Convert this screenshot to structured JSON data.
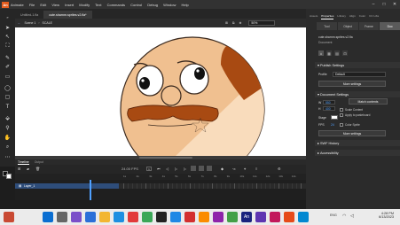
{
  "app": {
    "logo": "An",
    "menu": [
      "Animate",
      "File",
      "Edit",
      "View",
      "Insert",
      "Modify",
      "Text",
      "Commands",
      "Control",
      "Debug",
      "Window",
      "Help"
    ]
  },
  "document_tabs": [
    "Untitled-1.fla",
    "cute.sharnm.sprites.v2.fla*"
  ],
  "edit_bar": {
    "scene": "Scene 1",
    "symbol": "SCALE",
    "zoom": "50%"
  },
  "properties_panel": {
    "tabs": [
      "Assets",
      "Properties",
      "Library",
      "Align",
      "Color",
      "CC Libs"
    ],
    "view_tabs": [
      "Tool",
      "Object",
      "Frame",
      "Doc"
    ],
    "doc_name": "cute.sharnm.sprites.v2.fla",
    "doc_type": "Document",
    "publish_settings": {
      "title": "Publish Settings",
      "profile_label": "Profile",
      "profile_value": "Default",
      "more_button": "More settings"
    },
    "document_settings": {
      "title": "Document Settings",
      "w_label": "W",
      "w_value": "550",
      "h_label": "H",
      "h_value": "400",
      "match_contents": "Match contents",
      "scale_content": "Scale Content",
      "apply_pasteboard": "Apply to pasteboard",
      "stage_label": "Stage",
      "fps_label": "FPS",
      "fps_value": "24",
      "color_sprite": "Color Sprite",
      "more_button": "More settings"
    },
    "swf_history": "SWF History",
    "accessibility": "Accessibility"
  },
  "timeline": {
    "tabs": [
      "Timeline",
      "Output"
    ],
    "fps_display": "24.00",
    "fps_unit": "FPS",
    "frame_number": "1",
    "layer_name": "Layer_1",
    "ruler_labels": [
      "1s",
      "2s",
      "3s",
      "4s",
      "5s",
      "6s",
      "7s",
      "8s",
      "9s",
      "10s",
      "11s",
      "12s",
      "13s",
      "14s"
    ]
  },
  "taskbar": {
    "time": "4:28 PM",
    "date": "6/13/2023",
    "lang": "ENG"
  },
  "colors": {
    "face": "#f0c090",
    "face_stroke": "#3b2a1f",
    "patch": "#a84a12",
    "mustache": "#a84a12",
    "accent": "#e35d1f"
  }
}
